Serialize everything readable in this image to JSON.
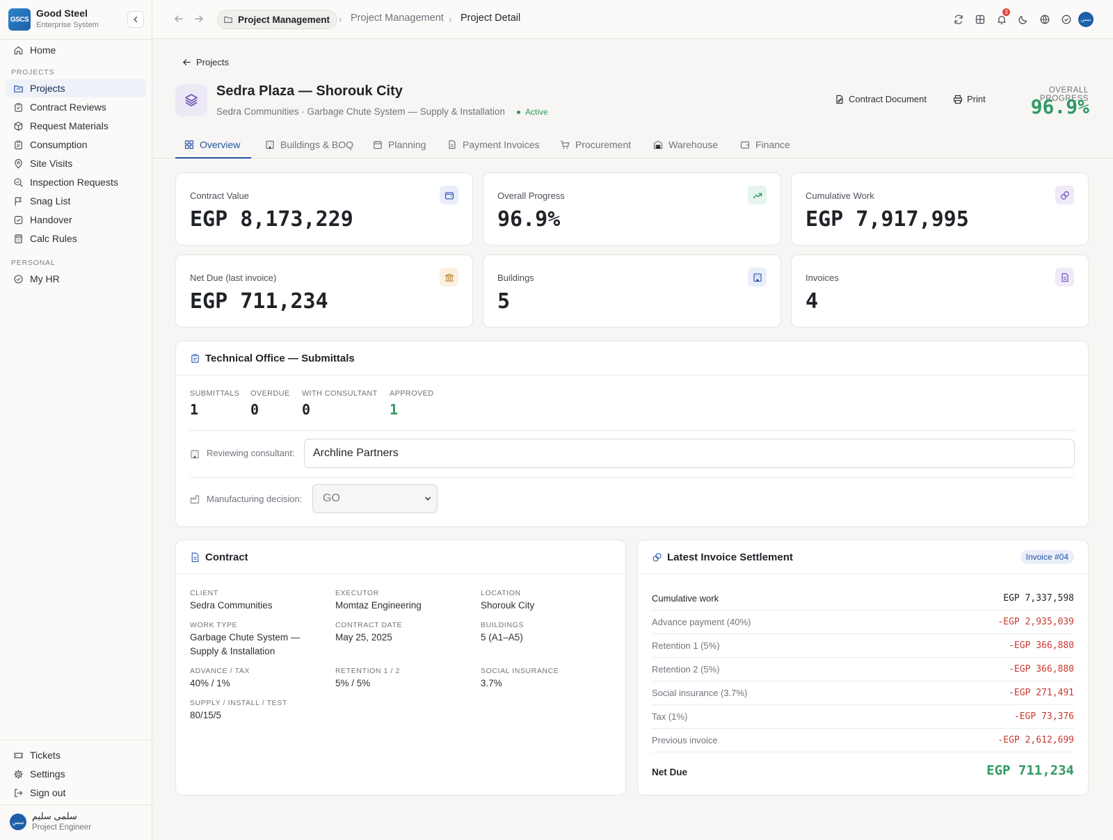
{
  "brand": {
    "logo": "GSCS",
    "name": "Good Steel",
    "subtitle": "Enterprise System"
  },
  "sidebar": {
    "home": "Home",
    "section_projects": "PROJECTS",
    "items": [
      {
        "label": "Projects",
        "icon": "folder-icon",
        "active": true
      },
      {
        "label": "Contract Reviews",
        "icon": "clipboard-icon"
      },
      {
        "label": "Request Materials",
        "icon": "package-icon"
      },
      {
        "label": "Consumption",
        "icon": "clipboard-icon"
      },
      {
        "label": "Site Visits",
        "icon": "map-pin-icon"
      },
      {
        "label": "Inspection Requests",
        "icon": "search-icon"
      },
      {
        "label": "Snag List",
        "icon": "flag-icon"
      },
      {
        "label": "Handover",
        "icon": "check-square-icon"
      },
      {
        "label": "Calc Rules",
        "icon": "calculator-icon"
      }
    ],
    "section_personal": "PERSONAL",
    "personal": [
      {
        "label": "My HR",
        "icon": "check-circle-icon"
      }
    ],
    "bottom": [
      {
        "label": "Tickets",
        "icon": "ticket-icon"
      },
      {
        "label": "Settings",
        "icon": "gear-icon"
      },
      {
        "label": "Sign out",
        "icon": "sign-out-icon"
      }
    ],
    "user": {
      "initials": "سس",
      "name": "سلمى سليم",
      "role": "Project Engineer"
    }
  },
  "topbar": {
    "crumb_pill": "Project Management",
    "crumb_2": "Project Management",
    "crumb_3": "Project Detail",
    "notification_count": "3",
    "avatar_initials": "سس"
  },
  "header": {
    "back_label": "Projects",
    "title": "Sedra Plaza — Shorouk City",
    "subtitle": "Sedra Communities · Garbage Chute System — Supply & Installation",
    "status": "Active",
    "contract_button": "Contract Document",
    "print_button": "Print",
    "overall_progress_label": "OVERALL PROGRESS",
    "overall_progress_value": "96.9%"
  },
  "tabs": [
    "Overview",
    "Buildings & BOQ",
    "Planning",
    "Payment Invoices",
    "Procurement",
    "Warehouse",
    "Finance"
  ],
  "stats": [
    {
      "label": "Contract Value",
      "value": "EGP 8,173,229",
      "icon": "wallet-icon",
      "color": "#3a63b6",
      "bg": "#e9eefa"
    },
    {
      "label": "Overall Progress",
      "value": "96.9%",
      "icon": "trending-up-icon",
      "color": "#2f9a62",
      "bg": "#e5f4ec"
    },
    {
      "label": "Cumulative Work",
      "value": "EGP 7,917,995",
      "icon": "coins-icon",
      "color": "#7a57c2",
      "bg": "#efe9f8"
    },
    {
      "label": "Net Due (last invoice)",
      "value": "EGP 711,234",
      "icon": "bank-icon",
      "color": "#b97a22",
      "bg": "#fbf0df"
    },
    {
      "label": "Buildings",
      "value": "5",
      "icon": "building-icon",
      "color": "#3a63b6",
      "bg": "#e9eefa"
    },
    {
      "label": "Invoices",
      "value": "4",
      "icon": "document-icon",
      "color": "#7a57c2",
      "bg": "#efe9f8"
    }
  ],
  "submittals": {
    "title": "Technical Office — Submittals",
    "kpis": [
      {
        "label": "SUBMITTALS",
        "value": "1"
      },
      {
        "label": "OVERDUE",
        "value": "0"
      },
      {
        "label": "WITH CONSULTANT",
        "value": "0"
      },
      {
        "label": "APPROVED",
        "value": "1",
        "color": "#2f9a62"
      }
    ],
    "consultant_label": "Reviewing consultant:",
    "consultant_value": "Archline Partners",
    "decision_label": "Manufacturing decision:",
    "decision_value": "GO"
  },
  "contract": {
    "title": "Contract",
    "fields": [
      {
        "label": "CLIENT",
        "value": "Sedra Communities"
      },
      {
        "label": "EXECUTOR",
        "value": "Momtaz Engineering"
      },
      {
        "label": "LOCATION",
        "value": "Shorouk City"
      },
      {
        "label": "WORK TYPE",
        "value": "Garbage Chute System — Supply & Installation"
      },
      {
        "label": "CONTRACT DATE",
        "value": "May 25, 2025"
      },
      {
        "label": "BUILDINGS",
        "value": "5 (A1–A5)"
      },
      {
        "label": "ADVANCE / TAX",
        "value": "40% / 1%"
      },
      {
        "label": "RETENTION 1 / 2",
        "value": "5% / 5%"
      },
      {
        "label": "SOCIAL INSURANCE",
        "value": "3.7%"
      },
      {
        "label": "SUPPLY / INSTALL / TEST",
        "value": "80/15/5"
      }
    ]
  },
  "settlement": {
    "title": "Latest Invoice Settlement",
    "badge": "Invoice #04",
    "rows": [
      {
        "label": "Cumulative work",
        "value": "EGP 7,337,598"
      },
      {
        "label": "Advance payment (40%)",
        "value": "-EGP 2,935,039"
      },
      {
        "label": "Retention 1 (5%)",
        "value": "-EGP 366,880"
      },
      {
        "label": "Retention 2 (5%)",
        "value": "-EGP 366,880"
      },
      {
        "label": "Social insurance (3.7%)",
        "value": "-EGP 271,491"
      },
      {
        "label": "Tax (1%)",
        "value": "-EGP 73,376"
      },
      {
        "label": "Previous invoice",
        "value": "-EGP 2,612,699"
      }
    ],
    "net_label": "Net Due",
    "net_value": "EGP 711,234"
  }
}
